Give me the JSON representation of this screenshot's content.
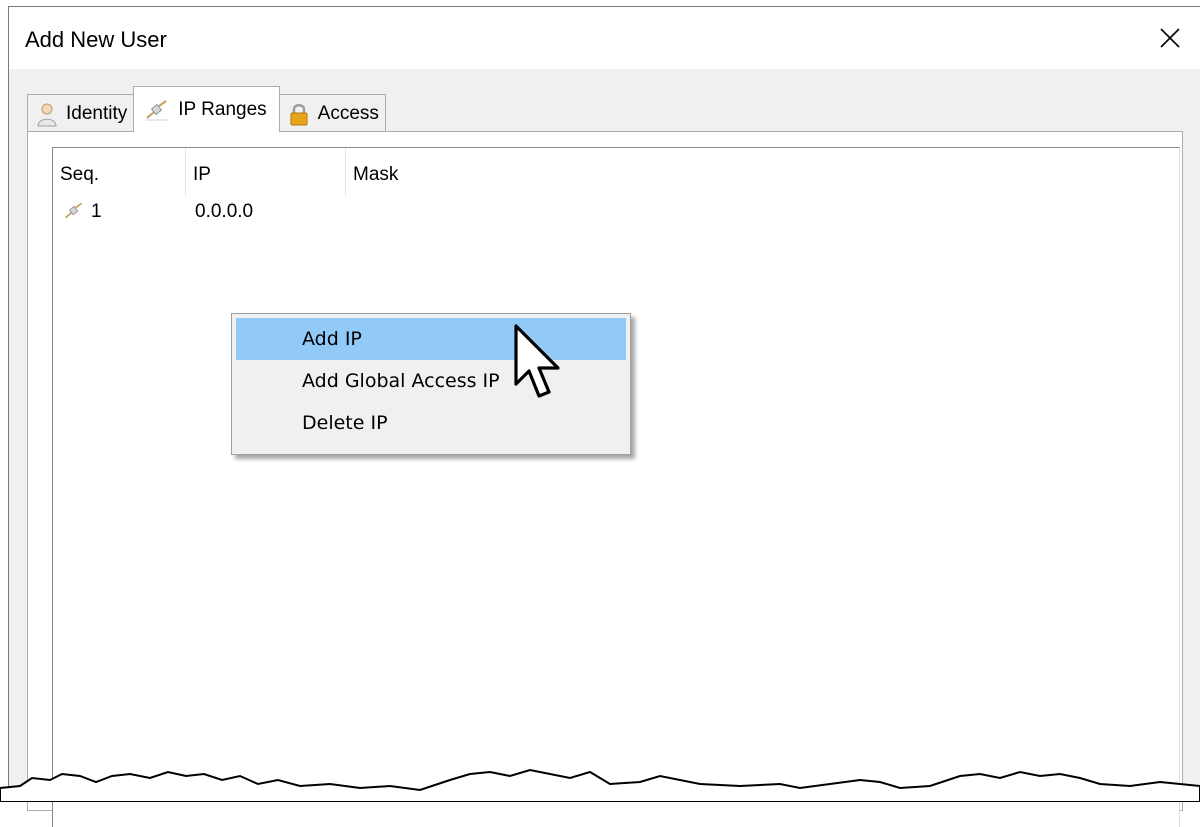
{
  "window": {
    "title": "Add New User",
    "close_glyph": "✕"
  },
  "tabs": [
    {
      "label": "Identity",
      "icon": "user-icon",
      "active": false
    },
    {
      "label": "IP Ranges",
      "icon": "network-plug-icon",
      "active": true
    },
    {
      "label": "Access",
      "icon": "lock-icon",
      "active": false
    }
  ],
  "ip_list": {
    "columns": [
      "Seq.",
      "IP",
      "Mask"
    ],
    "rows": [
      {
        "seq": "1",
        "ip": "0.0.0.0",
        "mask": "",
        "icon": "network-plug-icon"
      }
    ]
  },
  "context_menu": {
    "items": [
      {
        "label": "Add IP",
        "highlighted": true
      },
      {
        "label": "Add Global Access IP",
        "highlighted": false
      },
      {
        "label": "Delete IP",
        "highlighted": false
      }
    ]
  },
  "colors": {
    "menu_highlight": "#91c9f7",
    "dialog_bg": "#f0f0f0",
    "lock_gold": "#e8a317"
  }
}
